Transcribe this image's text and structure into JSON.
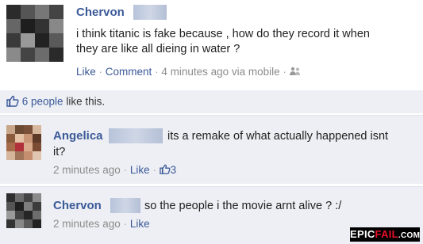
{
  "post": {
    "author": "Chervon",
    "text_line1": "i think titanic is fake because , how do they record it when",
    "text_line2": "they are like all dieing in water ?",
    "like_label": "Like",
    "comment_label": "Comment",
    "time": "4 minutes ago via mobile"
  },
  "likes": {
    "count_text": "6 people",
    "suffix": "like this."
  },
  "comments": [
    {
      "author": "Angelica",
      "text_line1": "its a remake of what actually happened isnt",
      "text_line2": "it?",
      "time": "2 minutes ago",
      "like_label": "Like",
      "like_count": "3"
    },
    {
      "author": "Chervon",
      "text_line1": "so the people i the movie arnt alive ? :/",
      "time": "2 minutes ago",
      "like_label": "Like"
    }
  ],
  "watermark": {
    "epic": "EPIC",
    "fail": "FAIL",
    "com": ".COM"
  },
  "icons": [
    "thumbs-up-icon",
    "friends-icon"
  ],
  "colors": {
    "link": "#3b5998",
    "panel": "#edeff4",
    "muted": "#8c8c8c"
  }
}
